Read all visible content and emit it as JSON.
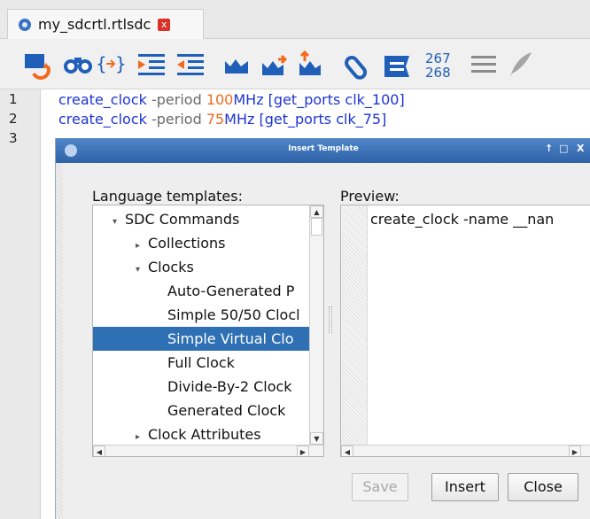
{
  "tab": {
    "label": "my_sdcrtl.rtlsdc",
    "close_glyph": "x"
  },
  "toolbar": {
    "line_numbers_icon_top": "267",
    "line_numbers_icon_bottom": "268",
    "icons": [
      "insert-block-icon",
      "find-icon",
      "insert-template-icon",
      "increase-indent-icon",
      "decrease-indent-icon",
      "block-comment-icon",
      "move-to-icon",
      "move-from-icon",
      "attach-icon",
      "bookmark-icon",
      "line-numbers-icon",
      "align-icon",
      "feather-icon"
    ]
  },
  "editor": {
    "line_numbers": [
      "1",
      "2",
      "3"
    ],
    "lines": [
      {
        "cmd": "create_clock",
        "opt": " -period ",
        "num": "100",
        "unit": "MHz",
        "rest": " [get_ports clk_100]"
      },
      {
        "cmd": "create_clock",
        "opt": " -period ",
        "num": "75",
        "unit": "MHz",
        "rest": " [get_ports clk_75]"
      }
    ]
  },
  "dialog": {
    "title": "Insert Template",
    "window_buttons": {
      "restore": "↑",
      "maximize": "□",
      "close": "X"
    },
    "language_label": "Language templates:",
    "preview_label": "Preview:",
    "tree": [
      {
        "label": "SDC Commands",
        "arrow": "▾"
      },
      {
        "label": "Collections",
        "arrow": "▸"
      },
      {
        "label": "Clocks",
        "arrow": "▾"
      },
      {
        "label": "Auto-Generated P"
      },
      {
        "label": "Simple 50/50 Clocl"
      },
      {
        "label": "Simple Virtual Clo"
      },
      {
        "label": "Full Clock"
      },
      {
        "label": "Divide-By-2 Clock"
      },
      {
        "label": "Generated Clock"
      },
      {
        "label": "Clock Attributes",
        "arrow": "▸"
      }
    ],
    "preview_text": "create_clock -name __nan",
    "buttons": {
      "save": "Save",
      "insert": "Insert",
      "close": "Close"
    }
  },
  "colors": {
    "accent": "#2f6fb3",
    "keyword": "#1d34d4",
    "number": "#f06a1f"
  }
}
